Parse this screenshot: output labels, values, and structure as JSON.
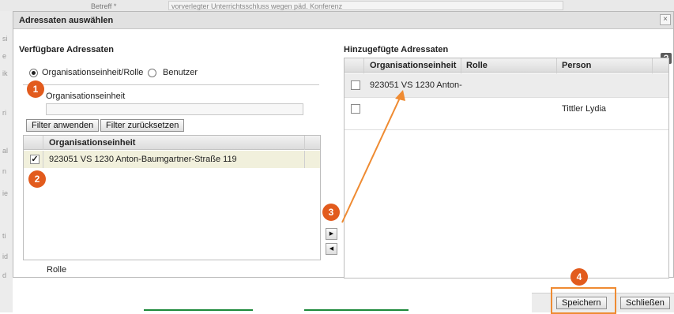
{
  "background": {
    "field_label": "Betreff *",
    "field_value": "vorverlegter Unterrichtsschluss wegen päd. Konferenz",
    "left_letters": [
      "si",
      "e",
      "ik",
      "ri",
      "al",
      "n",
      "ie",
      "ti",
      "id",
      "d"
    ]
  },
  "dialog": {
    "title": "Adressaten auswählen",
    "close_label": "×"
  },
  "available": {
    "title": "Verfügbare Adressaten",
    "radio_org_label": "Organisationseinheit/Rolle",
    "radio_user_label": "Benutzer",
    "field_label": "Organisationseinheit",
    "field_value": "",
    "filter_apply_label": "Filter anwenden",
    "filter_reset_label": "Filter zurücksetzen",
    "grid_header": "Organisationseinheit",
    "rows": [
      {
        "label": "923051 VS 1230 Anton-Baumgartner-Straße 119",
        "checked": true
      }
    ],
    "role_label": "Rolle"
  },
  "transfer": {
    "add_icon": "▶",
    "remove_icon": "◀"
  },
  "added": {
    "title": "Hinzugefügte Adressaten",
    "help_label": "?",
    "columns": [
      "Organisationseinheit",
      "Rolle",
      "Person"
    ],
    "rows": [
      {
        "org": "923051 VS 1230 Anton-",
        "role": "",
        "person": ""
      },
      {
        "org": "",
        "role": "",
        "person": "Tittler Lydia"
      }
    ]
  },
  "footer": {
    "save_label": "Speichern",
    "close_label": "Schließen"
  },
  "annotations": {
    "badges": [
      "1",
      "2",
      "3",
      "4"
    ],
    "accent_color": "#e25b1d",
    "arrow_color": "#ef8b32"
  }
}
